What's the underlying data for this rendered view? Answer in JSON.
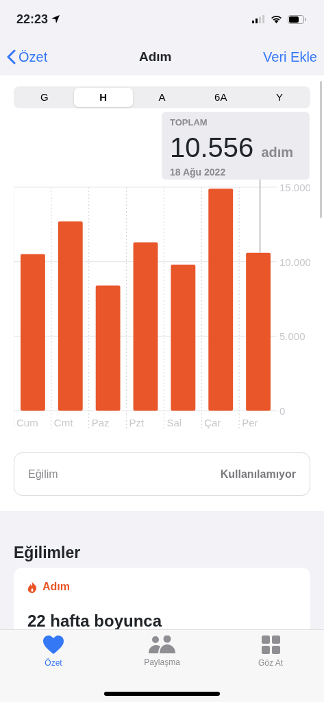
{
  "status_bar": {
    "time": "22:23"
  },
  "nav": {
    "back": "Özet",
    "title": "Adım",
    "action": "Veri Ekle"
  },
  "ranges": [
    {
      "label": "G",
      "selected": false
    },
    {
      "label": "H",
      "selected": true
    },
    {
      "label": "A",
      "selected": false
    },
    {
      "label": "6A",
      "selected": false
    },
    {
      "label": "Y",
      "selected": false
    }
  ],
  "summary": {
    "caption": "TOPLAM",
    "value": "10.556",
    "unit": "adım",
    "date": "18 Ağu 2022"
  },
  "chart_data": {
    "type": "bar",
    "categories": [
      "Cum",
      "Cmt",
      "Paz",
      "Pzt",
      "Sal",
      "Çar",
      "Per"
    ],
    "series": [
      {
        "color": "#e8562a",
        "values": [
          10500,
          12700,
          8400,
          11300,
          9800,
          14900,
          10600
        ]
      }
    ],
    "ylim": [
      0,
      15000
    ],
    "yticks": [
      {
        "value": 0,
        "label": "0"
      },
      {
        "value": 5000,
        "label": "5.000"
      },
      {
        "value": 10000,
        "label": "10.000"
      },
      {
        "value": 15000,
        "label": "15.000"
      }
    ],
    "annotations": [
      {
        "x": "Per"
      }
    ]
  },
  "trend_row": {
    "label": "Eğilim",
    "value": "Kullanılamıyor"
  },
  "trends": {
    "heading": "Eğilimler",
    "card_title": "Adım",
    "card_text": "22 hafta boyunca"
  },
  "tab_bar": [
    {
      "label": "Özet",
      "selected": true
    },
    {
      "label": "Paylaşma",
      "selected": false
    },
    {
      "label": "Göz At",
      "selected": false
    }
  ]
}
